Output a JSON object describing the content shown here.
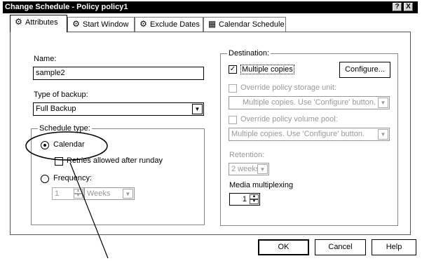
{
  "window": {
    "title": "Change Schedule - Policy policy1",
    "help_btn": "?",
    "close_btn": "X"
  },
  "tabs": [
    {
      "label": "Attributes",
      "icon": "attributes-icon"
    },
    {
      "label": "Start Window",
      "icon": "start-window-icon"
    },
    {
      "label": "Exclude Dates",
      "icon": "exclude-dates-icon"
    },
    {
      "label": "Calendar Schedule",
      "icon": "calendar-icon"
    }
  ],
  "left": {
    "name_label": "Name:",
    "name_value": "sample2",
    "type_label": "Type of backup:",
    "type_value": "Full Backup",
    "schedule_type": {
      "legend": "Schedule type:",
      "calendar_label": "Calendar",
      "calendar_selected": true,
      "retries_label": "Retries allowed after runday",
      "retries_checked": false,
      "frequency_label": "Frequency:",
      "frequency_selected": false,
      "frequency_value": "1",
      "frequency_unit": "Weeks"
    }
  },
  "right": {
    "destination": {
      "legend": "Destination:",
      "multiple_copies_label": "Multiple copies",
      "multiple_copies_checked": true,
      "configure_button": "Configure...",
      "override_storage_label": "Override policy storage unit:",
      "storage_value": "Multiple copies.  Use 'Configure' button.",
      "override_volume_label": "Override policy volume pool:",
      "volume_value": "Multiple copies.  Use 'Configure' button.",
      "retention_label": "Retention:",
      "retention_value": "2 weeks",
      "multiplexing_label": "Media multiplexing",
      "multiplexing_value": "1"
    }
  },
  "footer": {
    "ok": "OK",
    "cancel": "Cancel",
    "help": "Help"
  }
}
